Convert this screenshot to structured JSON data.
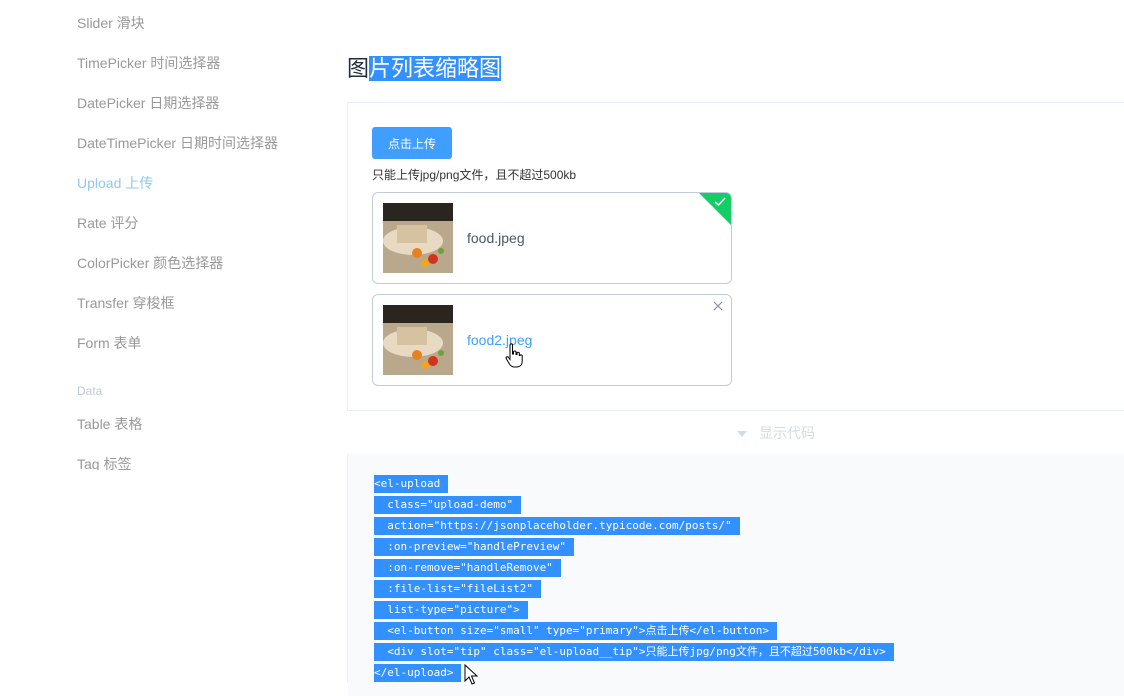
{
  "sidebar": {
    "items": [
      {
        "label": "Slider 滑块"
      },
      {
        "label": "TimePicker 时间选择器"
      },
      {
        "label": "DatePicker 日期选择器"
      },
      {
        "label": "DateTimePicker 日期时间选择器"
      },
      {
        "label": "Upload 上传",
        "active": true
      },
      {
        "label": "Rate 评分"
      },
      {
        "label": "ColorPicker 颜色选择器"
      },
      {
        "label": "Transfer 穿梭框"
      },
      {
        "label": "Form 表单"
      }
    ],
    "group_label": "Data",
    "data_items": [
      {
        "label": "Table 表格"
      },
      {
        "label": "Tag 标签"
      }
    ]
  },
  "main": {
    "title_plain": "图",
    "title_selected": "片列表缩略图",
    "upload_button": "点击上传",
    "tip": "只能上传jpg/png文件，且不超过500kb",
    "files": [
      {
        "name": "food.jpeg",
        "status": "success"
      },
      {
        "name": "food2.jpeg",
        "status": "hover"
      }
    ],
    "toggle_label": "显示代码"
  },
  "code_lines": [
    "<el-upload",
    "  class=\"upload-demo\"",
    "  action=\"https://jsonplaceholder.typicode.com/posts/\"",
    "  :on-preview=\"handlePreview\"",
    "  :on-remove=\"handleRemove\"",
    "  :file-list=\"fileList2\"",
    "  list-type=\"picture\">",
    "  <el-button size=\"small\" type=\"primary\">点击上传</el-button>",
    "  <div slot=\"tip\" class=\"el-upload__tip\">只能上传jpg/png文件，且不超过500kb</div>",
    "</el-upload>"
  ],
  "colors": {
    "primary": "#409eff",
    "success": "#13ce66",
    "selection": "#3390ff",
    "sidebar_active": "#8ec8f6"
  },
  "icons": [
    "check-icon",
    "close-icon",
    "caret-down-icon",
    "hand-pointer-icon",
    "arrow-pointer-icon",
    "food-thumbnail"
  ]
}
